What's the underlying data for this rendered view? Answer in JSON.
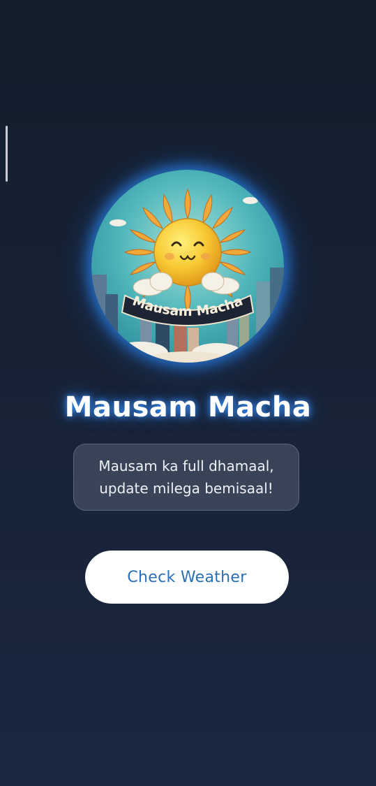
{
  "app": {
    "title": "Mausam Macha",
    "tagline_line1": "Mausam ka full dhamaal,",
    "tagline_line2": "update milega bemisaal!",
    "cta_label": "Check Weather"
  },
  "logo": {
    "text": "Mausam Macha",
    "icon": "smiling-sun-logo"
  },
  "colors": {
    "background": "#172235",
    "glow": "#2882e6",
    "button_text": "#2a6fb5",
    "sun": "#f6c93a",
    "sky": "#4bb8bc"
  }
}
